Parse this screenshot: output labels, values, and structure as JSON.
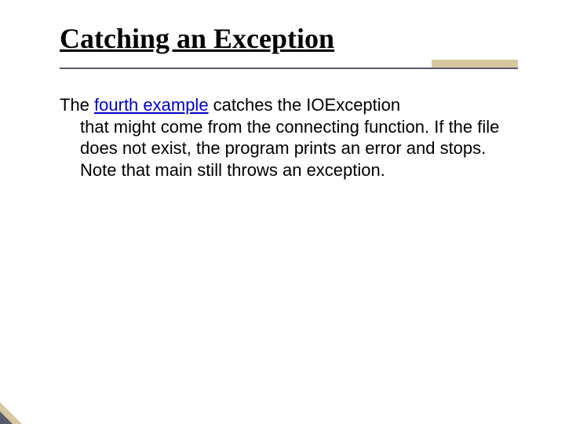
{
  "title": "Catching an Exception",
  "body": {
    "prefix": "The ",
    "link_text": "fourth example",
    "after_link": " catches the IOException ",
    "rest": "that might come from the connecting function. If the file does not exist, the program prints an error and stops. Note that main still throws an exception."
  }
}
